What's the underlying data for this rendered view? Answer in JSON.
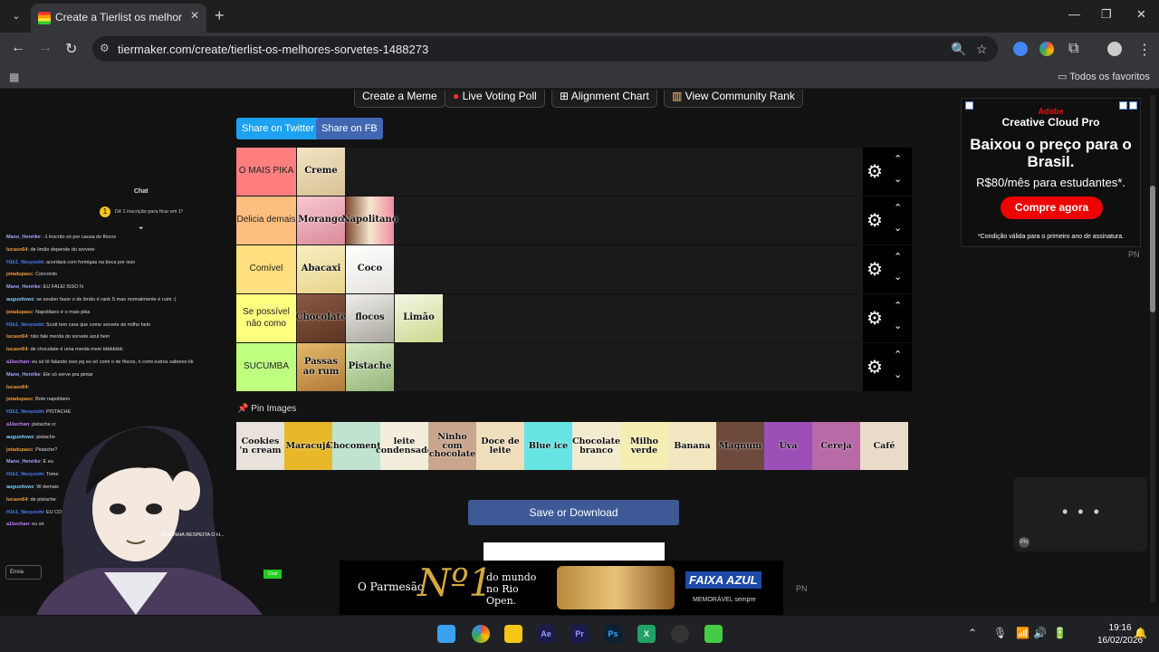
{
  "browser": {
    "tab_title": "Create a Tierlist os melhores sorvetes",
    "url": "tiermaker.com/create/tierlist-os-melhores-sorvetes-1488273",
    "bookmark_folder": "Todos os favoritos"
  },
  "top_buttons": [
    "Create a Meme",
    "Live Voting Poll",
    "Alignment Chart",
    "View Community Rank"
  ],
  "share": {
    "twitter": "Share on Twitter",
    "fb": "Share on FB"
  },
  "tiers": [
    {
      "label": "O MAIS PIKA",
      "color": "#ff7f7f",
      "items": [
        "Creme"
      ]
    },
    {
      "label": "Delicia demais",
      "color": "#ffbf7f",
      "items": [
        "Morango",
        "Napolitano"
      ]
    },
    {
      "label": "Comível",
      "color": "#ffdf7f",
      "items": [
        "Abacaxi",
        "Coco"
      ]
    },
    {
      "label": "Se possível não como",
      "color": "#ffff7f",
      "items": [
        "Chocolate",
        "flocos",
        "Limão"
      ]
    },
    {
      "label": "SUCUMBA",
      "color": "#bfff7f",
      "items": [
        "Passas ao rum",
        "Pistache"
      ]
    }
  ],
  "pin_images_label": "Pin Images",
  "pool": [
    "Cookies 'n cream",
    "Maracujá",
    "Chocomenta",
    "leite condensado",
    "Ninho com chocolate",
    "Doce de leite",
    "Blue ice",
    "Chocolate branco",
    "Milho verde",
    "Banana",
    "Magnum",
    "Uva",
    "Cereja",
    "Café"
  ],
  "save_label": "Save or Download",
  "ad_right": {
    "brand": "Adobe",
    "product": "Creative Cloud Pro",
    "headline": "Baixou o preço para o Brasil.",
    "price": "R$80/mês para estudantes*.",
    "cta": "Compre agora",
    "note": "*Condição válida para o primeiro ano de assinatura."
  },
  "pn": "PN",
  "ad_bottom": {
    "left": "O Parmesão",
    "big": "Nº1",
    "mid": "do mundo no Rio Open.",
    "brand": "FAIXA AZUL",
    "tag": "MEMORÁVEL sempre"
  },
  "stream": {
    "chat_title": "Chat",
    "sub_text": "Dê 1 inscrição para ficar em 1º",
    "send_label": "Envia",
    "chat_tab": "Chat",
    "lines": [
      {
        "user": "Mano_Henrike",
        "text": "-1 inscrito só por causa do flocos",
        "color": "#9fa8ff"
      },
      {
        "user": "lucasn64",
        "text": "de limão depende do sorvete",
        "color": "#f29d38"
      },
      {
        "user": "H1k1_Neoyoshi",
        "text": "acordará com formigas na boca por isso",
        "color": "#4d7cff"
      },
      {
        "user": "jotadupasc",
        "text": "Concordo",
        "color": "#f29d38"
      },
      {
        "user": "Mano_Henrike",
        "text": "EU FALEI ISSO N",
        "color": "#9fa8ff"
      },
      {
        "user": "augusttowz",
        "text": "se souber fazer o de limão é rank S mas normalmente é ruim :(",
        "color": "#7fd0ff"
      },
      {
        "user": "jotadupasc",
        "text": "Napolitano é o mais pika",
        "color": "#f29d38"
      },
      {
        "user": "H1k1_Neoyoshi",
        "text": "Scott tem cara que come sorvete de milho hein",
        "color": "#4d7cff"
      },
      {
        "user": "lucasn64",
        "text": "não fale merda do sorvete azul hein",
        "color": "#f29d38"
      },
      {
        "user": "lucasn64",
        "text": "de chocolate é uma merda msm kkkkkkkk",
        "color": "#f29d38"
      },
      {
        "user": "a1kechan",
        "text": "eu só tô falando isso pq eu só comi o de flocos, n comi outros sabores kk",
        "color": "#c77dff"
      },
      {
        "user": "Mano_Henrike",
        "text": "Ele só serve pra pintar",
        "color": "#9fa8ff"
      },
      {
        "user": "lucasn64",
        "text": "",
        "color": "#f29d38"
      },
      {
        "user": "jotadupasc",
        "text": "Bote napolitano",
        "color": "#f29d38"
      },
      {
        "user": "H1k1_Neoyoshi",
        "text": "PISTACHE",
        "color": "#4d7cff"
      },
      {
        "user": "a1kechan",
        "text": "pistache cr",
        "color": "#c77dff"
      },
      {
        "user": "augusttowz",
        "text": "pistache",
        "color": "#7fd0ff"
      },
      {
        "user": "jotadupasc",
        "text": "Pistache?",
        "color": "#f29d38"
      },
      {
        "user": "Mano_Henrike",
        "text": "E eu",
        "color": "#9fa8ff"
      },
      {
        "user": "H1k1_Neoyoshi",
        "text": "Tome",
        "color": "#4d7cff"
      },
      {
        "user": "augusttowz",
        "text": "W demais",
        "color": "#7fd0ff"
      },
      {
        "user": "lucasn64",
        "text": "de pistache",
        "color": "#f29d38"
      },
      {
        "user": "H1k1_Neoyoshi",
        "text": "EU CO",
        "color": "#4d7cff"
      },
      {
        "user": "a1kechan",
        "text": "eu só",
        "color": "#c77dff"
      }
    ],
    "overlay_text": "MODINHA RESPEITA O H..."
  },
  "taskbar": {
    "time": "19:16",
    "date": "16/02/2026"
  }
}
